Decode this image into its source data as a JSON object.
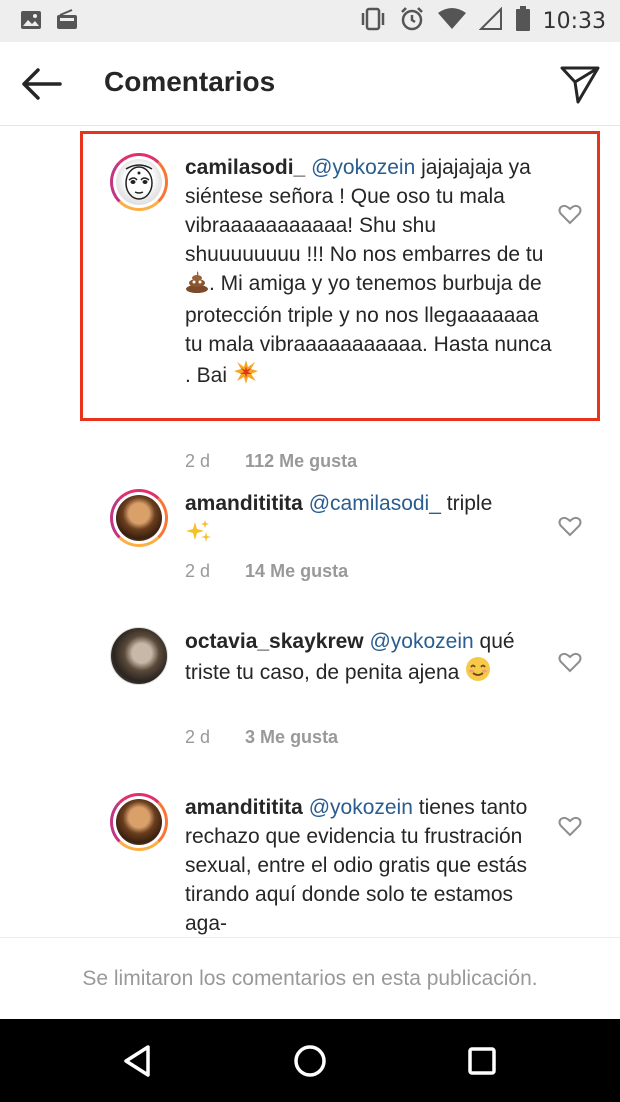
{
  "status_bar": {
    "time": "10:33",
    "icons": [
      "image-icon",
      "radio-icon",
      "vibrate-icon",
      "alarm-icon",
      "wifi-icon",
      "signal-icon",
      "battery-icon"
    ]
  },
  "header": {
    "title": "Comentarios",
    "back_icon": "arrow-left-icon",
    "send_icon": "paper-plane-icon"
  },
  "comments": [
    {
      "username": "camilasodi_",
      "mention": "@yokozein",
      "text_before_emoji": " jajajajaja ya siéntese señora ! Que oso tu mala vibraaaaaaaaaaa! Shu shu shuuuuuuuu !!! No nos embarres de tu ",
      "emoji_1": "poop-emoji",
      "text_after_emoji": ". Mi amiga y yo tenemos burbuja de protección triple y no nos llegaaaaaaa tu mala vibraaaaaaaaaaa. Hasta nunca . Bai ",
      "emoji_2": "collision-emoji",
      "time": "2 d",
      "likes": "112 Me gusta",
      "highlighted": true
    },
    {
      "username": "amandititita",
      "mention": "@camilasodi_",
      "text": " triple",
      "emoji": "sparkles-emoji",
      "time": "2 d",
      "likes": "14 Me gusta"
    },
    {
      "username": "octavia_skaykrew",
      "mention": "@yokozein",
      "text": " qué triste tu caso, de penita ajena ",
      "emoji": "smiling-face-emoji",
      "time": "2 d",
      "likes": "3 Me gusta"
    },
    {
      "username": "amandititita",
      "mention": "@yokozein",
      "text": " tienes tanto rechazo que evidencia tu frustración sexual, entre el odio gratis que estás tirando aquí donde solo te estamos aga-"
    }
  ],
  "footer": {
    "text": "Se limitaron los comentarios en esta publicación."
  },
  "nav_bar": {
    "icons": [
      "back-triangle-icon",
      "home-circle-icon",
      "recents-square-icon"
    ]
  },
  "colors": {
    "highlight_border": "#e8341c",
    "mention": "#2a5c8f",
    "muted": "#999999",
    "status_bar_bg": "#eeeeee",
    "nav_bar_bg": "#000000"
  }
}
